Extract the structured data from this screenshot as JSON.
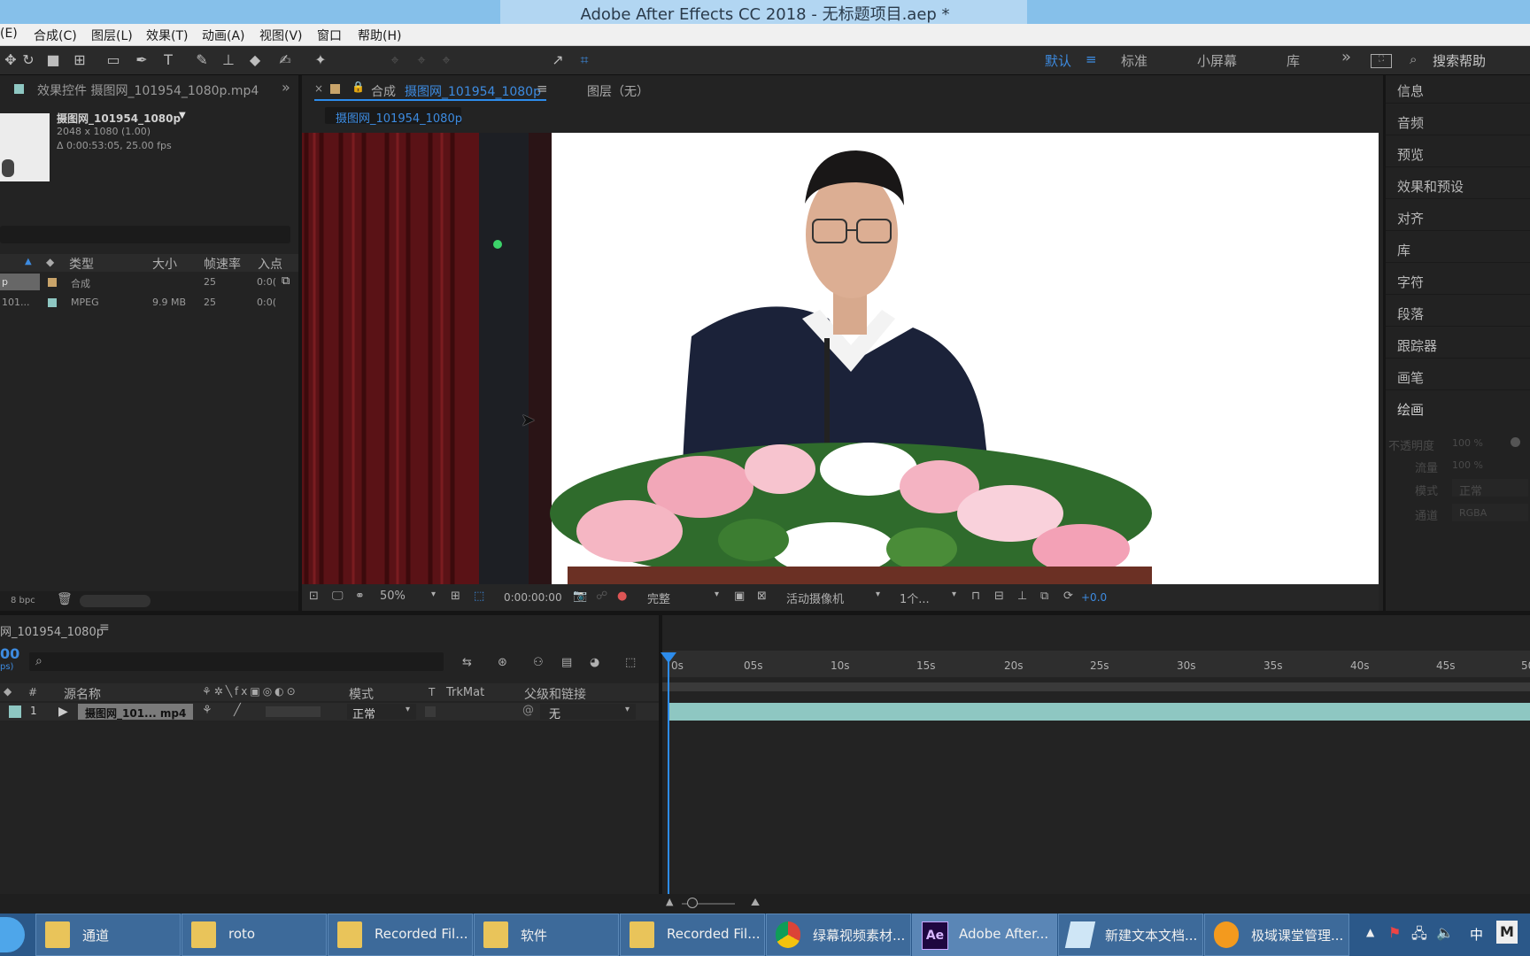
{
  "window": {
    "title": "Adobe After Effects CC 2018 - 无标题项目.aep *"
  },
  "menu": [
    "(E)",
    "合成(C)",
    "图层(L)",
    "效果(T)",
    "动画(A)",
    "视图(V)",
    "窗口",
    "帮助(H)"
  ],
  "toolbar": {
    "align_label": "对齐",
    "workspaces": [
      "默认",
      "标准",
      "小屏幕",
      "库"
    ],
    "search_placeholder": "搜索帮助",
    "more": "»"
  },
  "project_panel": {
    "effects_tab": "效果控件 摄图网_101954_1080p.mp4",
    "item_name": "摄图网_101954_1080p",
    "item_dims": "2048 x 1080 (1.00)",
    "item_duration": "Δ 0:00:53:05, 25.00 fps",
    "columns": [
      "类型",
      "大小",
      "帧速率",
      "入点"
    ],
    "rows": [
      {
        "name": "p",
        "type": "合成",
        "size": "",
        "fps": "25",
        "in": "0:0("
      },
      {
        "name": "101...",
        "type": "MPEG",
        "size": "9.9 MB",
        "fps": "25",
        "in": "0:0("
      }
    ],
    "bpc": "8 bpc"
  },
  "comp_panel": {
    "tab_label": "合成",
    "tab_name": "摄图网_101954_1080p",
    "layer_tab": "图层（无）",
    "subtab": "摄图网_101954_1080p",
    "zoom": "50%",
    "timecode": "0:00:00:00",
    "quality": "完整",
    "camera": "活动摄像机",
    "views": "1个...",
    "exposure": "+0.0"
  },
  "right_panel": {
    "items": [
      "信息",
      "音频",
      "预览",
      "效果和预设",
      "对齐",
      "库",
      "字符",
      "段落",
      "跟踪器",
      "画笔",
      "绘画"
    ],
    "paint": [
      {
        "label": "不透明度",
        "value": "100 %"
      },
      {
        "label": "流量",
        "value": "100 %"
      },
      {
        "label": "模式",
        "value": "正常"
      },
      {
        "label": "通道",
        "value": "RGBA"
      }
    ]
  },
  "timeline": {
    "tab": "网_101954_1080p",
    "timecode": "00",
    "time_sub": "ps)",
    "columns": {
      "num": "#",
      "source": "源名称",
      "mode": "模式",
      "t": "T",
      "trkmat": "TrkMat",
      "parent": "父级和链接"
    },
    "layer": {
      "num": "1",
      "name": "摄图网_101... mp4",
      "mode": "正常",
      "parent": "无"
    },
    "ticks": [
      "0s",
      "05s",
      "10s",
      "15s",
      "20s",
      "25s",
      "30s",
      "35s",
      "40s",
      "45s",
      "50"
    ]
  },
  "taskbar": [
    {
      "label": "通道",
      "icon": "folder-icon"
    },
    {
      "label": "roto",
      "icon": "folder-icon"
    },
    {
      "label": "Recorded Fil...",
      "icon": "folder-icon"
    },
    {
      "label": "软件",
      "icon": "folder-icon"
    },
    {
      "label": "Recorded Fil...",
      "icon": "folder-icon"
    },
    {
      "label": "绿幕视频素材...",
      "icon": "chrome-icon"
    },
    {
      "label": "Adobe After...",
      "icon": "ae-icon"
    },
    {
      "label": "新建文本文档...",
      "icon": "notepad-icon"
    },
    {
      "label": "极域课堂管理...",
      "icon": "classroom-icon"
    }
  ],
  "tray": {
    "ime": "中",
    "m": "M"
  },
  "colors": {
    "accent": "#2d8ceb",
    "clip": "#8ec7c2",
    "titlebar": "#86c0ea",
    "taskbar": "#2b5889"
  }
}
